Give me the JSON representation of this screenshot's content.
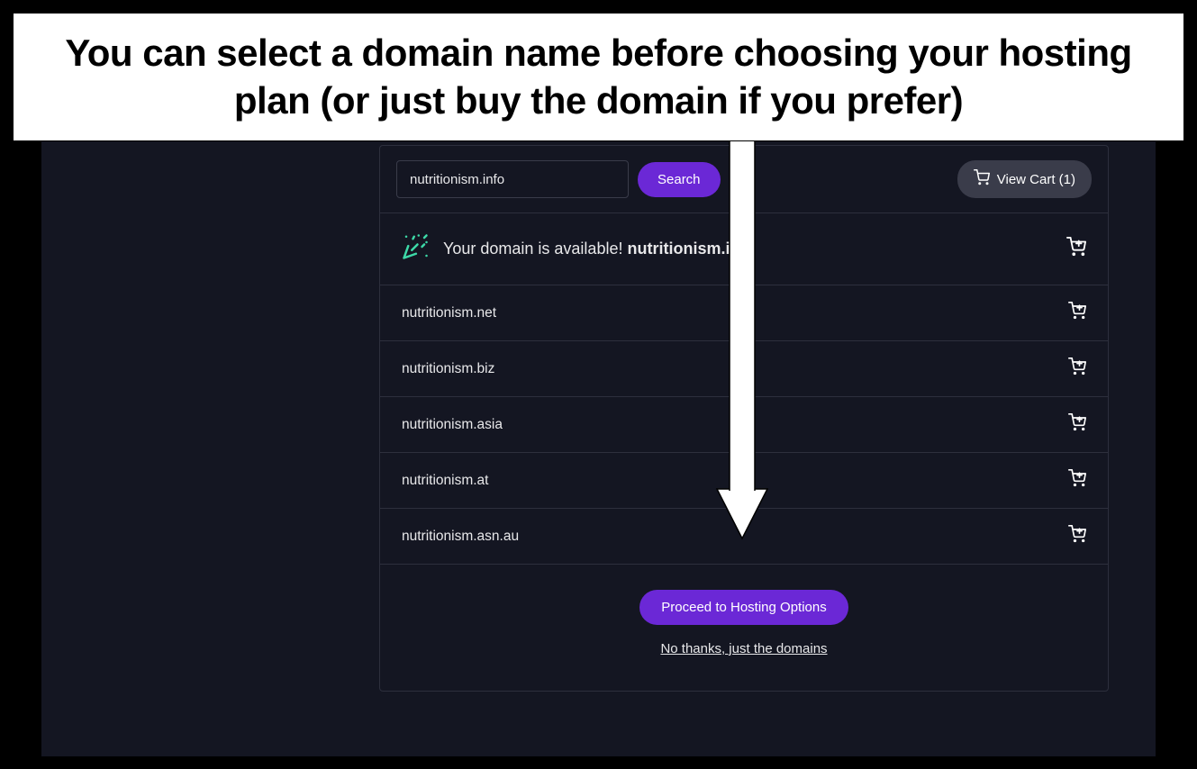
{
  "annotation": {
    "text": "You can select a domain name before choosing your hosting plan (or just buy the domain if you prefer)"
  },
  "search": {
    "value": "nutritionism.info",
    "button_label": "Search"
  },
  "cart": {
    "label": "View Cart (1)"
  },
  "available": {
    "prefix": "Your domain is available! ",
    "domain": "nutritionism.info"
  },
  "suggestions": [
    {
      "name": "nutritionism.net"
    },
    {
      "name": "nutritionism.biz"
    },
    {
      "name": "nutritionism.asia"
    },
    {
      "name": "nutritionism.at"
    },
    {
      "name": "nutritionism.asn.au"
    }
  ],
  "footer": {
    "proceed_label": "Proceed to Hosting Options",
    "no_thanks_label": "No thanks, just the domains"
  }
}
